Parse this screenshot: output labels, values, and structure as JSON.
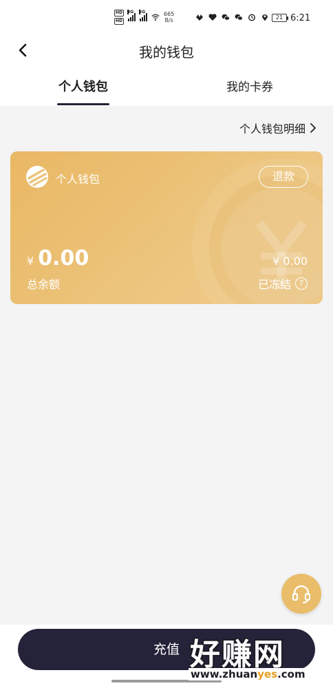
{
  "status_bar": {
    "net_speed_value": "665",
    "net_speed_unit": "B/s",
    "battery": "21",
    "time": "6:21",
    "hd_label": "HD",
    "net_4g": "4G",
    "net_5g": "5G"
  },
  "header": {
    "title": "我的钱包"
  },
  "tabs": [
    {
      "label": "个人钱包",
      "active": true
    },
    {
      "label": "我的卡券",
      "active": false
    }
  ],
  "detail_link": "个人钱包明细",
  "wallet_card": {
    "name": "个人钱包",
    "refund_label": "退款",
    "currency": "¥",
    "balance": "0.00",
    "balance_label": "总余额",
    "frozen_amount": "¥ 0.00",
    "frozen_label": "已冻结",
    "help_symbol": "?"
  },
  "support_icon": "headset-icon",
  "bottom": {
    "recharge_label": "充值"
  },
  "watermark": {
    "big": "好赚网",
    "small_pre": "www.zhuan",
    "small_hl": "yes",
    "small_post": ".com"
  },
  "colors": {
    "card_gold": "#ecc47c",
    "button_dark": "#25233a",
    "support_gold": "#e9bd6a"
  }
}
